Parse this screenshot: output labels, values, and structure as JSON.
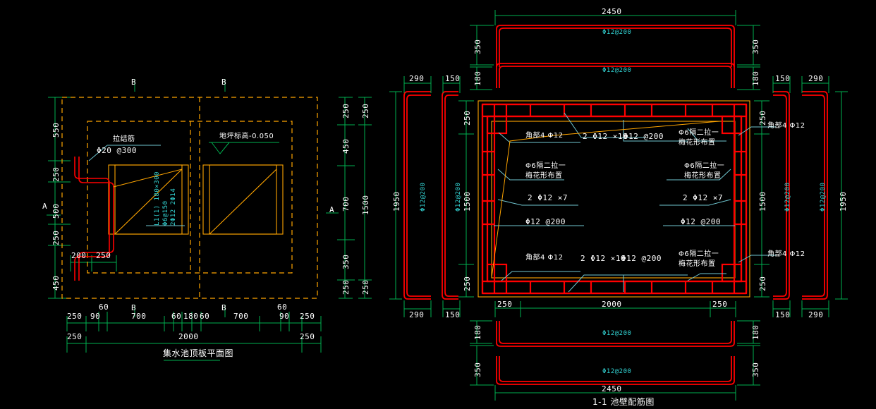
{
  "app": {
    "background": "#000000",
    "palette": {
      "rebar_red": "#ff0000",
      "dimension_green": "#00b050",
      "outline_orange": "#ffa500",
      "annotation_cyan": "#33d6d6",
      "text_white": "#ffffff",
      "leader_cyan": "#6fc6d0"
    }
  },
  "drawings": [
    {
      "id": "plan",
      "title": "集水池顶板平面图",
      "section_marks": [
        "B",
        "B",
        "A",
        "A"
      ],
      "annotations": [
        {
          "name": "tie-bar",
          "line1": "拉结筋",
          "line2": "Φ20 @300"
        },
        {
          "name": "floor-level",
          "text": "地坪标高-0.050"
        },
        {
          "name": "beam-label",
          "line1": "L1(1) 180×300",
          "line2": "Φ6@150",
          "line3": "2Φ12 2Φ14"
        }
      ],
      "dims_left": [
        "550",
        "250",
        "500",
        "250",
        "450"
      ],
      "dims_right_inner": [
        "250",
        "450",
        "700",
        "350",
        "250"
      ],
      "dims_right_outer": [
        "250",
        "1500",
        "250"
      ],
      "dims_bottom_inner": [
        "250",
        "90",
        "60",
        "700",
        "60",
        "180",
        "60",
        "700",
        "60",
        "90",
        "250"
      ],
      "dims_bottom_outer": [
        "250",
        "2000",
        "250"
      ],
      "dims_detail": [
        "200",
        "250"
      ]
    },
    {
      "id": "section",
      "title": "1-1 池壁配筋图",
      "dim_top_overall": "2450",
      "dim_bottom_overall": "2450",
      "dims_top_side": [
        "350",
        "180"
      ],
      "dims_bottom_side": [
        "180",
        "350"
      ],
      "dims_left_strips": [
        "290",
        "150"
      ],
      "dims_right_strips": [
        "150",
        "290"
      ],
      "dims_inner_vertical": [
        "250",
        "1500",
        "250"
      ],
      "dims_outer_vertical": [
        "1950",
        "1950"
      ],
      "dims_inner_horizontal": [
        "250",
        "2000",
        "250"
      ],
      "bar_labels": {
        "slab_top_1": "Φ12@200",
        "slab_top_2": "Φ12@200",
        "slab_bottom_1": "Φ12@200",
        "slab_bottom_2": "Φ12@200",
        "wall_left_1": "Φ12@200",
        "wall_left_2": "Φ12@200",
        "wall_right_1": "Φ12@200",
        "wall_right_2": "Φ12@200"
      },
      "callouts": {
        "corner_bars": "角部4 Φ12",
        "top_bars": "2 Φ12 ×10",
        "spacing": "Φ12 @200",
        "tie_line1": "Φ6隔二拉一",
        "tie_line2": "梅花形布置",
        "side_bars": "2 Φ12 ×7",
        "wall_spacing": "Φ12 @200"
      }
    }
  ]
}
